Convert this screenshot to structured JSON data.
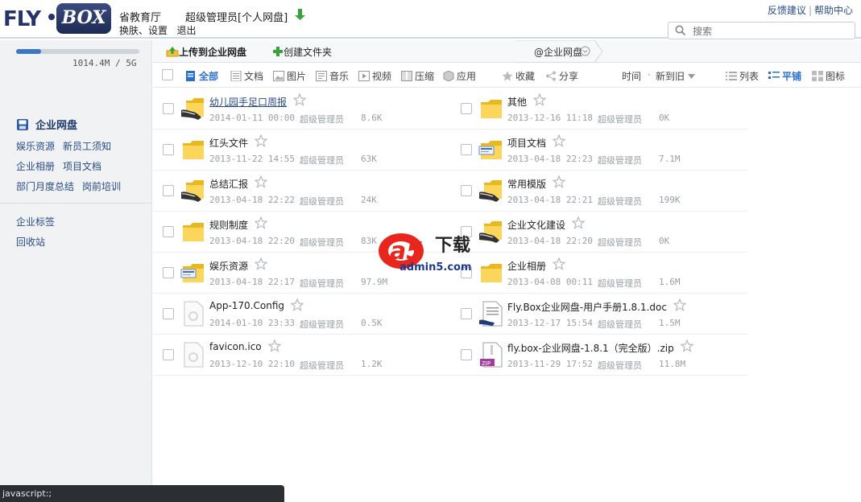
{
  "header": {
    "logo_fly": "FLY",
    "logo_box": "BOX",
    "dept": "省教育厅",
    "user": "超级管理员[个人网盘]",
    "links": [
      "换肤",
      "设置",
      "退出"
    ],
    "right_links": [
      "反馈建议",
      "帮助中心"
    ],
    "search_placeholder": "搜索"
  },
  "sidebar": {
    "quota_text": "1014.4M / 5G",
    "quota_fraction": 0.2,
    "title": "企业网盘",
    "items": [
      "娱乐资源",
      "新员工须知",
      "企业相册",
      "项目文档",
      "部门月度总结",
      "岗前培训"
    ],
    "items2": [
      "企业标签",
      "回收站"
    ]
  },
  "actionbar": {
    "upload": "上传到企业网盘",
    "new_folder": "创建文件夹",
    "crumb": "@企业网盘"
  },
  "toolbar": {
    "all": "全部",
    "doc": "文档",
    "img": "图片",
    "music": "音乐",
    "video": "视频",
    "zip": "压缩",
    "app": "应用",
    "fav": "收藏",
    "share": "分享",
    "sort_time": "时间",
    "sort_order": "新到旧",
    "view_list": "列表",
    "view_tile": "平铺",
    "view_icon": "图标"
  },
  "files": [
    {
      "name": "幼儿园手足口周报",
      "date": "2014-01-11 00:00",
      "owner": "超级管理员",
      "size": "8.6K",
      "icon": "shared-folder-icon",
      "link": true
    },
    {
      "name": "其他",
      "date": "2013-12-16 11:18",
      "owner": "超级管理员",
      "size": "0K",
      "icon": "folder-icon"
    },
    {
      "name": "红头文件",
      "date": "2013-11-22 14:55",
      "owner": "超级管理员",
      "size": "63K",
      "icon": "folder-icon"
    },
    {
      "name": "项目文档",
      "date": "2013-04-18 22:23",
      "owner": "超级管理员",
      "size": "7.1M",
      "icon": "doc-folder-icon"
    },
    {
      "name": "总结汇报",
      "date": "2013-04-18 22:22",
      "owner": "超级管理员",
      "size": "24K",
      "icon": "shared-folder-icon"
    },
    {
      "name": "常用模版",
      "date": "2013-04-18 22:21",
      "owner": "超级管理员",
      "size": "199K",
      "icon": "shared-folder-icon"
    },
    {
      "name": "规则制度",
      "date": "2013-04-18 22:20",
      "owner": "超级管理员",
      "size": "83K",
      "icon": "folder-icon"
    },
    {
      "name": "企业文化建设",
      "date": "2013-04-18 22:20",
      "owner": "超级管理员",
      "size": "0K",
      "icon": "shared-folder-icon"
    },
    {
      "name": "娱乐资源",
      "date": "2013-04-18 22:17",
      "owner": "超级管理员",
      "size": "97.9M",
      "icon": "doc-folder-icon"
    },
    {
      "name": "企业相册",
      "date": "2013-04-08 00:11",
      "owner": "超级管理员",
      "size": "1.6M",
      "icon": "folder-icon"
    },
    {
      "name": "App-170.Config",
      "date": "2014-01-10 23:33",
      "owner": "超级管理员",
      "size": "0.5K",
      "icon": "file-icon"
    },
    {
      "name": "Fly.Box企业网盘-用户手册1.8.1.doc",
      "date": "2013-12-17 15:54",
      "owner": "超级管理员",
      "size": "1.5M",
      "icon": "word-doc-icon"
    },
    {
      "name": "favicon.ico",
      "date": "2013-12-10 22:10",
      "owner": "超级管理员",
      "size": "1.2K",
      "icon": "file-icon"
    },
    {
      "name": "fly.box-企业网盘-1.8.1（完全版）.zip",
      "date": "2013-11-29 17:52",
      "owner": "超级管理员",
      "size": "11.8M",
      "icon": "zip-file-icon"
    }
  ],
  "watermark": {
    "brand": "a5",
    "text": "下载",
    "site": "admin5.com"
  },
  "status_tip": "javascript:;"
}
